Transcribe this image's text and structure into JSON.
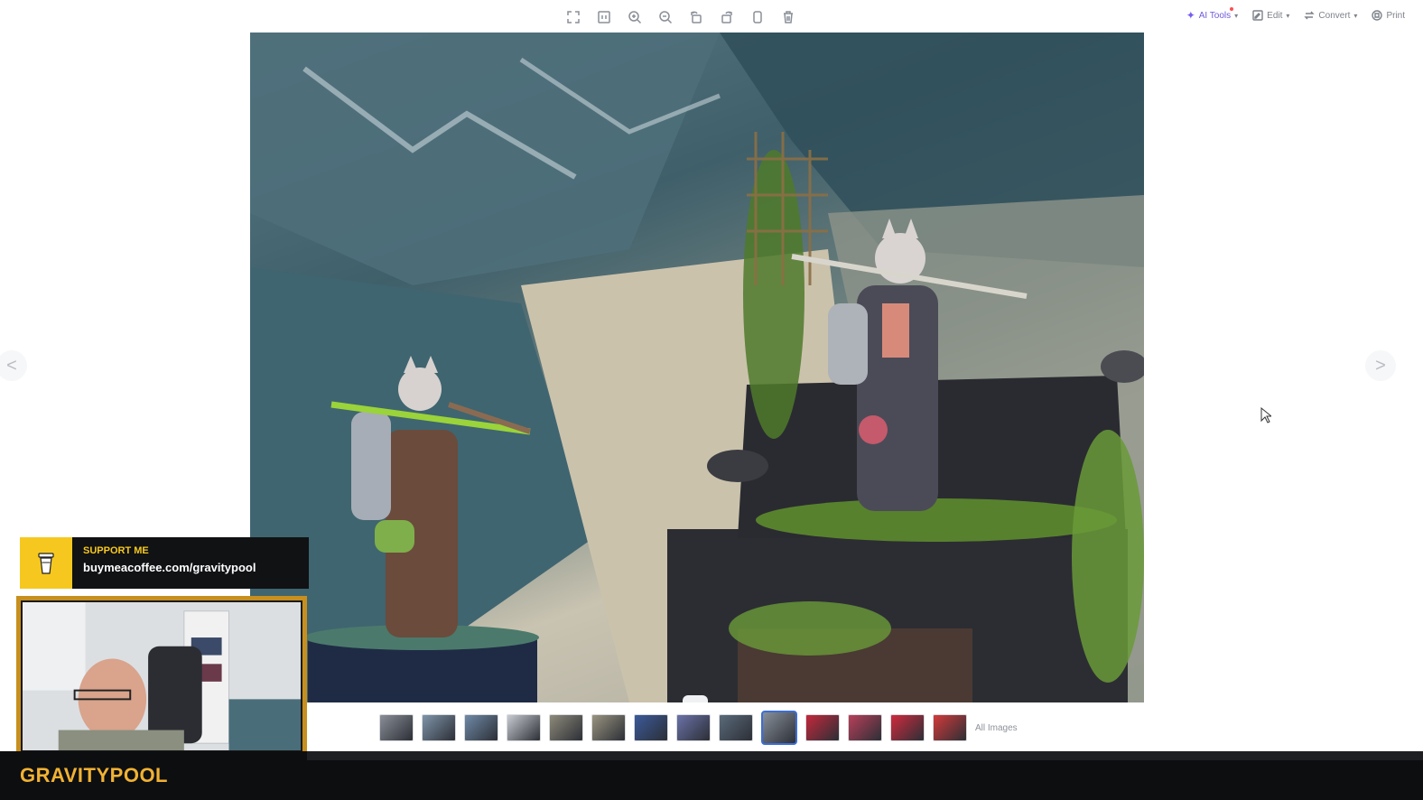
{
  "toolbar": {
    "center_icons": [
      "fit-screen-icon",
      "actual-size-icon",
      "zoom-in-icon",
      "zoom-out-icon",
      "rotate-left-icon",
      "rotate-right-icon",
      "copy-icon",
      "delete-icon"
    ],
    "ai_tools_label": "AI Tools",
    "edit_label": "Edit",
    "convert_label": "Convert",
    "print_label": "Print"
  },
  "viewer": {
    "prev_label": "<",
    "next_label": ">",
    "all_images_label": "All Images",
    "thumbnail_count": 14,
    "active_thumbnail_index": 9
  },
  "stream_overlay": {
    "support_label": "SUPPORT ME",
    "support_url": "buymeacoffee.com/gravitypool",
    "streamer_name": "GRAVITYPOOL"
  },
  "colors": {
    "accent": "#3b6ed6",
    "ai_purple": "#6e5bd8",
    "overlay_yellow": "#f6c81f",
    "streamer_gold": "#f1b233"
  }
}
